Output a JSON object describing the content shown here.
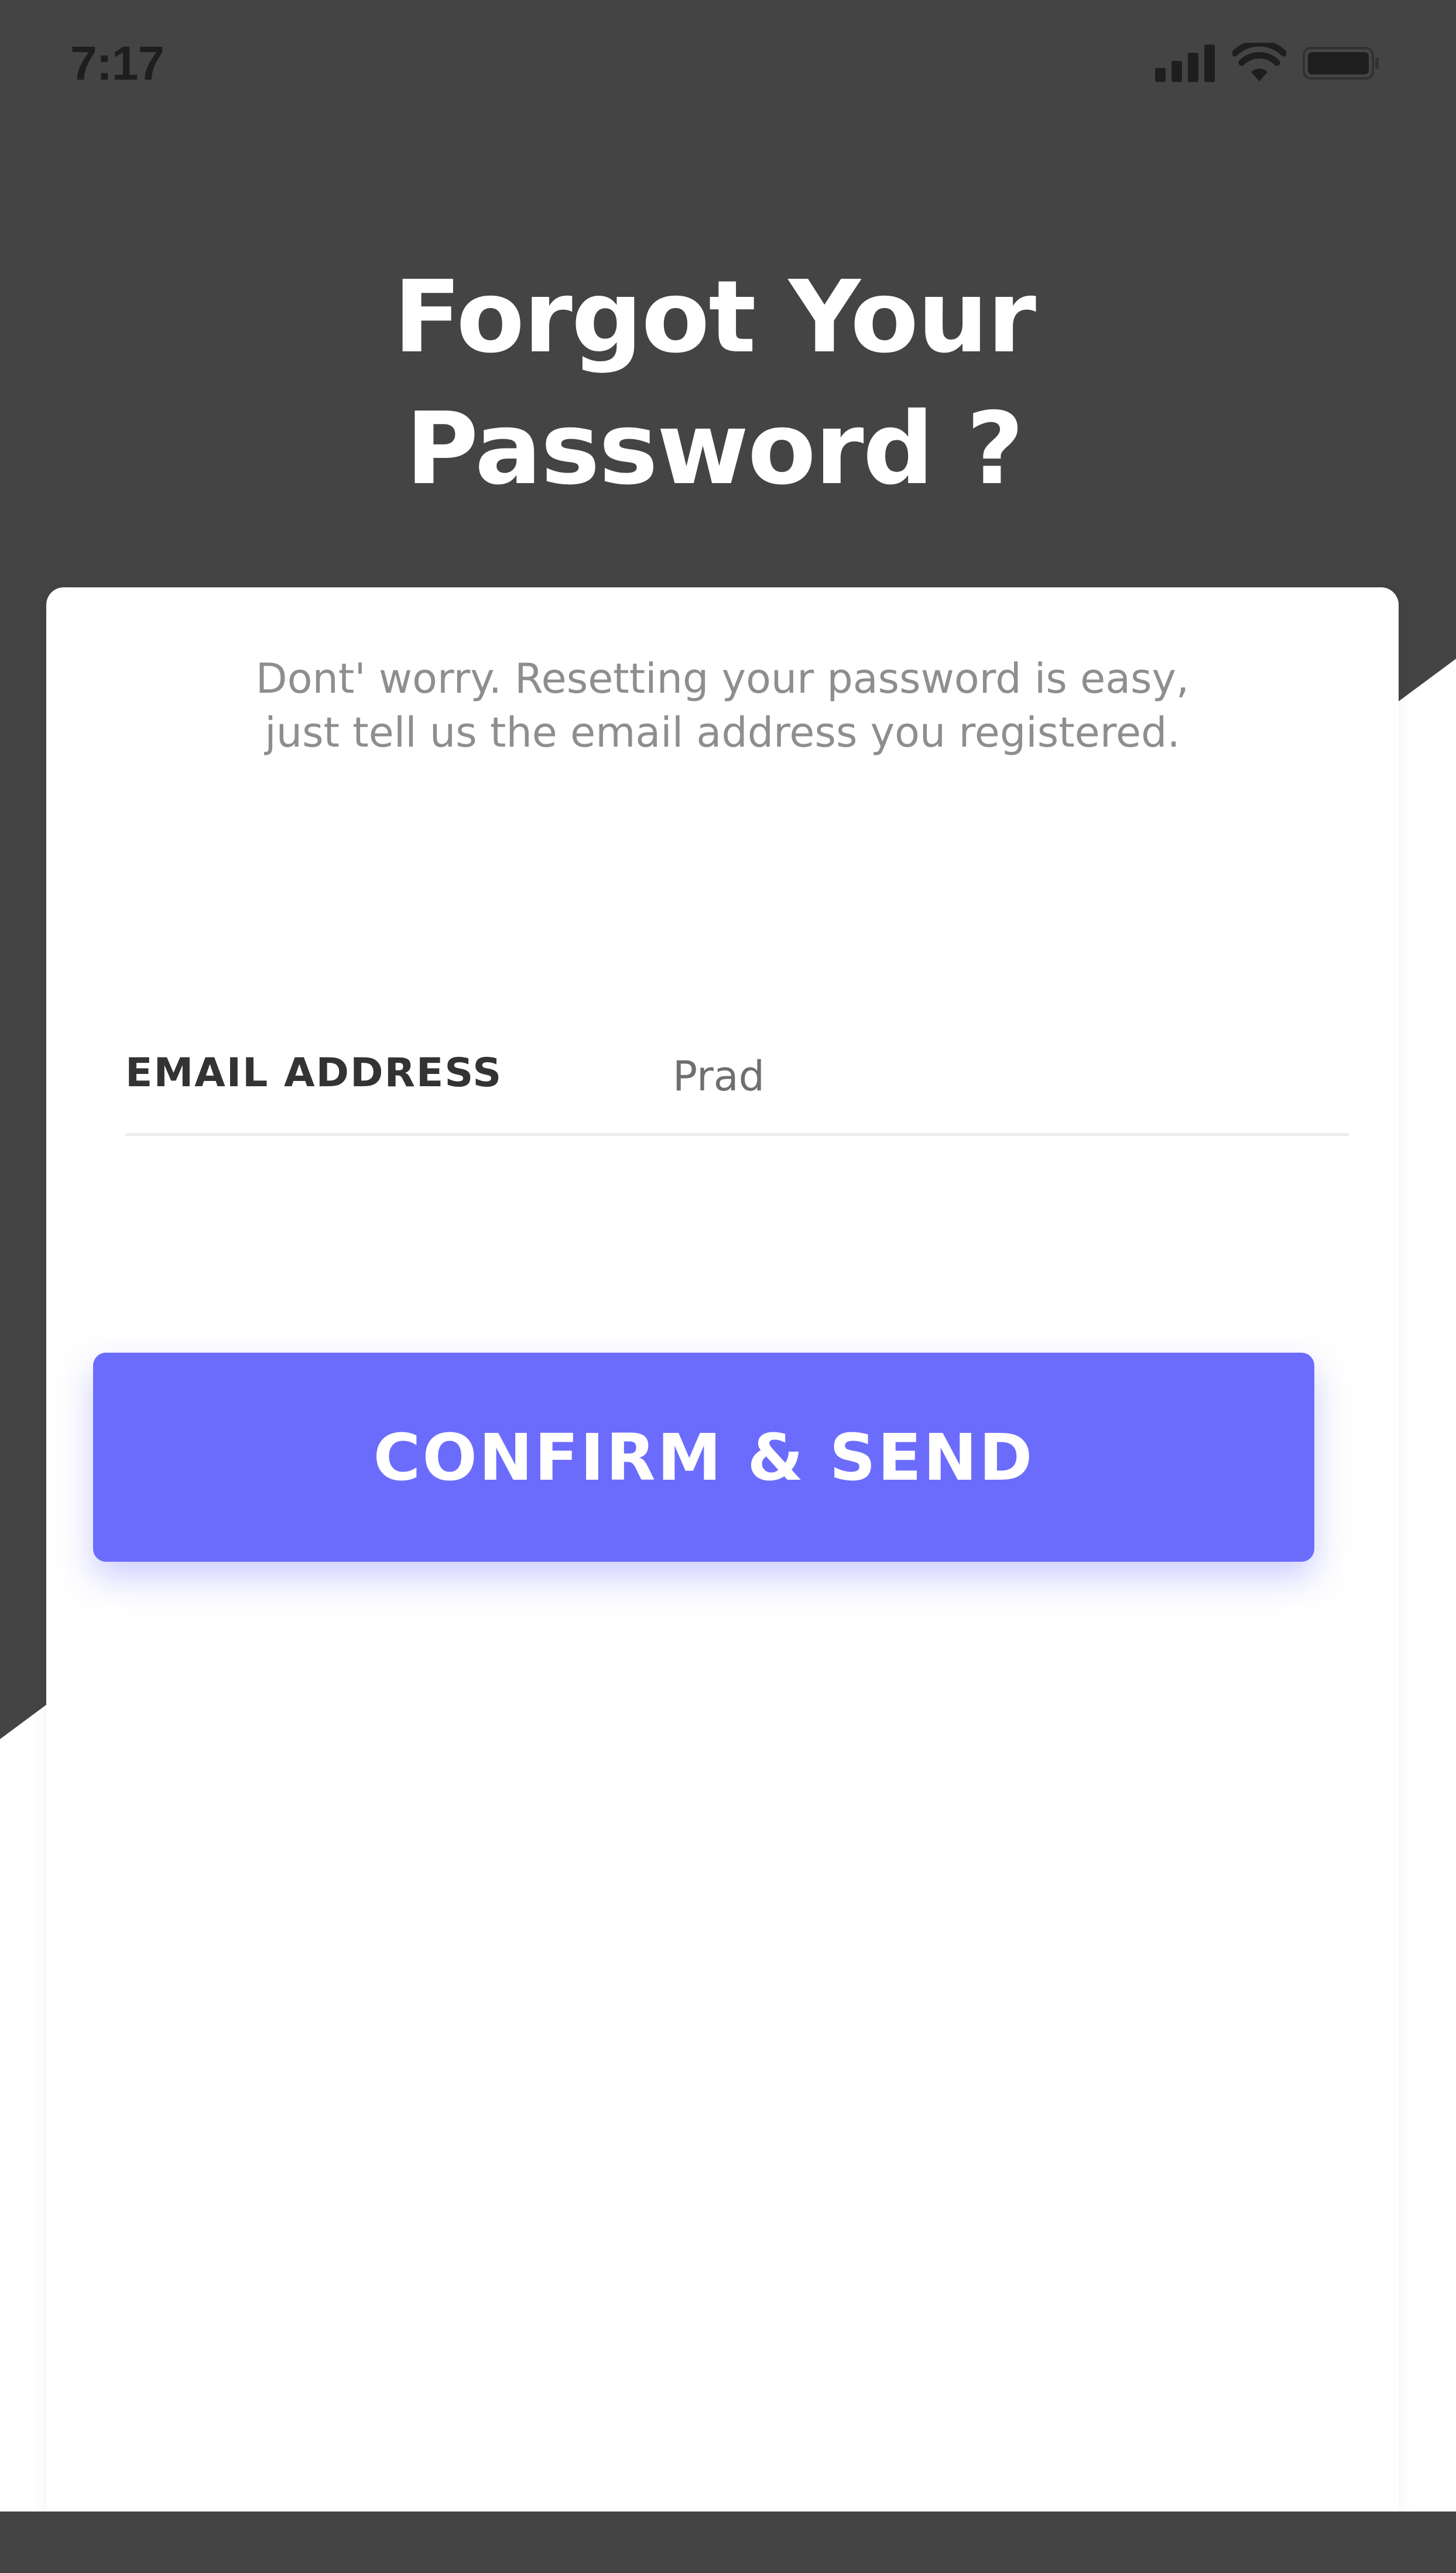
{
  "status_bar": {
    "time": "7:17",
    "icons": [
      "cellular-signal-icon",
      "wifi-icon",
      "battery-icon"
    ]
  },
  "header": {
    "title_line1": "Forgot Your",
    "title_line2": "Password ?"
  },
  "card": {
    "subtitle_line1": "Dont' worry. Resetting your password is easy,",
    "subtitle_line2": "just tell us the email address you registered.",
    "email_field": {
      "label": "EMAIL ADDRESS",
      "value": "Prad",
      "placeholder": ""
    },
    "confirm_button_label": "CONFIRM & SEND"
  },
  "colors": {
    "background_dark": "#444444",
    "accent": "#6c6cfc",
    "card": "#ffffff",
    "title_text": "#ffffff",
    "muted_text": "#8e8e8e",
    "label_text": "#333333"
  }
}
